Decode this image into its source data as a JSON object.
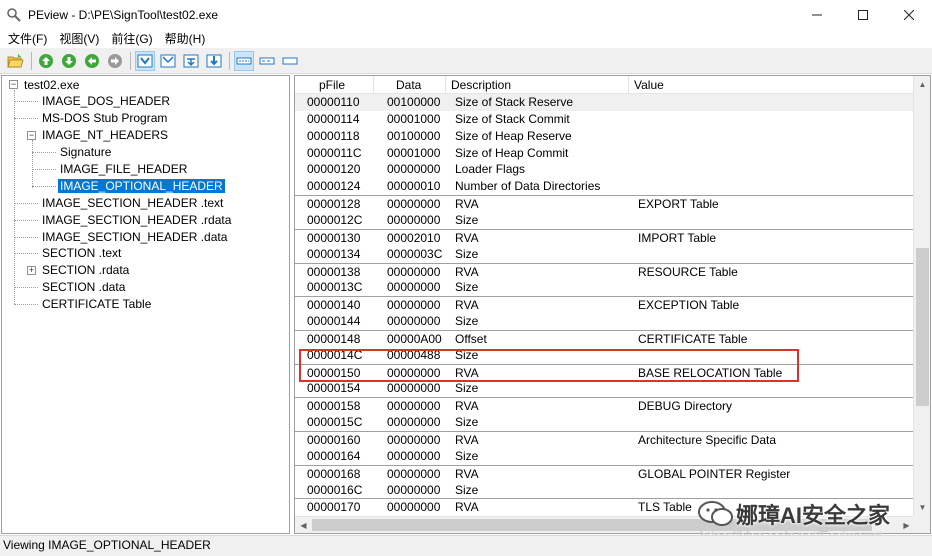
{
  "window": {
    "title": "PEview - D:\\PE\\SignTool\\test02.exe",
    "minimize_glyph": "—",
    "maximize_glyph": "☐",
    "close_glyph": "✕"
  },
  "menu": [
    "文件(F)",
    "视图(V)",
    "前往(G)",
    "帮助(H)"
  ],
  "toolbar": {
    "buttons": [
      "open-icon",
      "up-icon",
      "down-icon",
      "back-icon",
      "forward-icon",
      "view-bytes-icon",
      "view-words-icon",
      "view-dwords-icon",
      "view-qwords-icon",
      "view-list-icon",
      "view-list2-icon",
      "view-list3-icon"
    ]
  },
  "tree": {
    "items": [
      {
        "label": "test02.exe",
        "level": 0,
        "expander": "−"
      },
      {
        "label": "IMAGE_DOS_HEADER",
        "level": 1
      },
      {
        "label": "MS-DOS Stub Program",
        "level": 1
      },
      {
        "label": "IMAGE_NT_HEADERS",
        "level": 1,
        "expander": "−"
      },
      {
        "label": "Signature",
        "level": 2
      },
      {
        "label": "IMAGE_FILE_HEADER",
        "level": 2
      },
      {
        "label": "IMAGE_OPTIONAL_HEADER",
        "level": 2,
        "selected": true
      },
      {
        "label": "IMAGE_SECTION_HEADER .text",
        "level": 1
      },
      {
        "label": "IMAGE_SECTION_HEADER .rdata",
        "level": 1
      },
      {
        "label": "IMAGE_SECTION_HEADER .data",
        "level": 1
      },
      {
        "label": "SECTION .text",
        "level": 1
      },
      {
        "label": "SECTION .rdata",
        "level": 1,
        "expander": "+"
      },
      {
        "label": "SECTION .data",
        "level": 1
      },
      {
        "label": "CERTIFICATE Table",
        "level": 1
      }
    ]
  },
  "list": {
    "columns": [
      "pFile",
      "Data",
      "Description",
      "Value"
    ],
    "rows": [
      {
        "pfile": "00000110",
        "data": "00100000",
        "desc": "Size of Stack Reserve",
        "value": "",
        "first": true
      },
      {
        "pfile": "00000114",
        "data": "00001000",
        "desc": "Size of Stack Commit",
        "value": ""
      },
      {
        "pfile": "00000118",
        "data": "00100000",
        "desc": "Size of Heap Reserve",
        "value": ""
      },
      {
        "pfile": "0000011C",
        "data": "00001000",
        "desc": "Size of Heap Commit",
        "value": ""
      },
      {
        "pfile": "00000120",
        "data": "00000000",
        "desc": "Loader Flags",
        "value": ""
      },
      {
        "pfile": "00000124",
        "data": "00000010",
        "desc": "Number of Data Directories",
        "value": ""
      },
      {
        "pfile": "00000128",
        "data": "00000000",
        "desc": "RVA",
        "value": "EXPORT Table",
        "sep": true
      },
      {
        "pfile": "0000012C",
        "data": "00000000",
        "desc": "Size",
        "value": ""
      },
      {
        "pfile": "00000130",
        "data": "00002010",
        "desc": "RVA",
        "value": "IMPORT Table",
        "sep": true
      },
      {
        "pfile": "00000134",
        "data": "0000003C",
        "desc": "Size",
        "value": ""
      },
      {
        "pfile": "00000138",
        "data": "00000000",
        "desc": "RVA",
        "value": "RESOURCE Table",
        "sep": true
      },
      {
        "pfile": "0000013C",
        "data": "00000000",
        "desc": "Size",
        "value": ""
      },
      {
        "pfile": "00000140",
        "data": "00000000",
        "desc": "RVA",
        "value": "EXCEPTION Table",
        "sep": true
      },
      {
        "pfile": "00000144",
        "data": "00000000",
        "desc": "Size",
        "value": ""
      },
      {
        "pfile": "00000148",
        "data": "00000A00",
        "desc": "Offset",
        "value": "CERTIFICATE Table",
        "sep": true
      },
      {
        "pfile": "0000014C",
        "data": "00000488",
        "desc": "Size",
        "value": ""
      },
      {
        "pfile": "00000150",
        "data": "00000000",
        "desc": "RVA",
        "value": "BASE RELOCATION Table",
        "sep": true
      },
      {
        "pfile": "00000154",
        "data": "00000000",
        "desc": "Size",
        "value": ""
      },
      {
        "pfile": "00000158",
        "data": "00000000",
        "desc": "RVA",
        "value": "DEBUG Directory",
        "sep": true
      },
      {
        "pfile": "0000015C",
        "data": "00000000",
        "desc": "Size",
        "value": ""
      },
      {
        "pfile": "00000160",
        "data": "00000000",
        "desc": "RVA",
        "value": "Architecture Specific Data",
        "sep": true
      },
      {
        "pfile": "00000164",
        "data": "00000000",
        "desc": "Size",
        "value": ""
      },
      {
        "pfile": "00000168",
        "data": "00000000",
        "desc": "RVA",
        "value": "GLOBAL POINTER Register",
        "sep": true
      },
      {
        "pfile": "0000016C",
        "data": "00000000",
        "desc": "Size",
        "value": ""
      },
      {
        "pfile": "00000170",
        "data": "00000000",
        "desc": "RVA",
        "value": "TLS Table",
        "sep": true
      }
    ],
    "highlight_color": "#e0302a"
  },
  "watermark": {
    "name": "娜璋AI安全之家",
    "url": "https://blog.csdn.net/Eastmount"
  },
  "status": {
    "text": "Viewing IMAGE_OPTIONAL_HEADER"
  },
  "colors": {
    "selection": "#0078d7",
    "accent_green": "#3ea83b",
    "accent_blue": "#1e78c8"
  }
}
